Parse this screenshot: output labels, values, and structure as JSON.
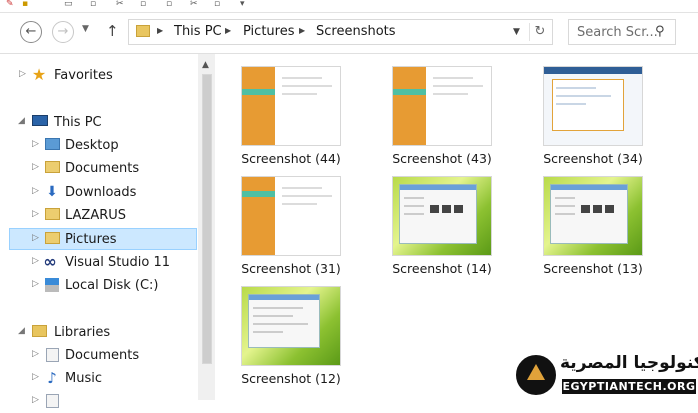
{
  "address_bar": {
    "crumbs": [
      "This PC",
      "Pictures",
      "Screenshots"
    ]
  },
  "search": {
    "placeholder": "Search Scr..."
  },
  "nav_pane": {
    "items": [
      {
        "label": "Favorites",
        "icon": "star-icon"
      },
      {
        "label": "This PC",
        "icon": "computer-icon"
      },
      {
        "label": "Desktop",
        "icon": "folder-icon"
      },
      {
        "label": "Documents",
        "icon": "documents-icon"
      },
      {
        "label": "Downloads",
        "icon": "downloads-icon"
      },
      {
        "label": "LAZARUS",
        "icon": "folder-icon"
      },
      {
        "label": "Pictures",
        "icon": "pictures-folder-icon",
        "selected": true
      },
      {
        "label": "Visual Studio 11",
        "icon": "visual-studio-icon"
      },
      {
        "label": "Local Disk (C:)",
        "icon": "disk-icon"
      },
      {
        "label": "Libraries",
        "icon": "libraries-icon"
      },
      {
        "label": "Documents",
        "icon": "documents-icon"
      },
      {
        "label": "Music",
        "icon": "music-icon"
      }
    ]
  },
  "files": [
    {
      "name": "Screenshot (44)",
      "style": "orange"
    },
    {
      "name": "Screenshot (43)",
      "style": "orange"
    },
    {
      "name": "Screenshot (34)",
      "style": "blue"
    },
    {
      "name": "Screenshot (31)",
      "style": "orange"
    },
    {
      "name": "Screenshot (14)",
      "style": "green"
    },
    {
      "name": "Screenshot (13)",
      "style": "green"
    },
    {
      "name": "Screenshot (12)",
      "style": "green"
    }
  ],
  "watermark": {
    "arabic": "التكنولوجيا المصرية",
    "english": "EGYPTIANTECH.ORG"
  },
  "colors": {
    "selection": "#cce8ff",
    "selection_border": "#99d1ff",
    "folder": "#eccd6f"
  }
}
